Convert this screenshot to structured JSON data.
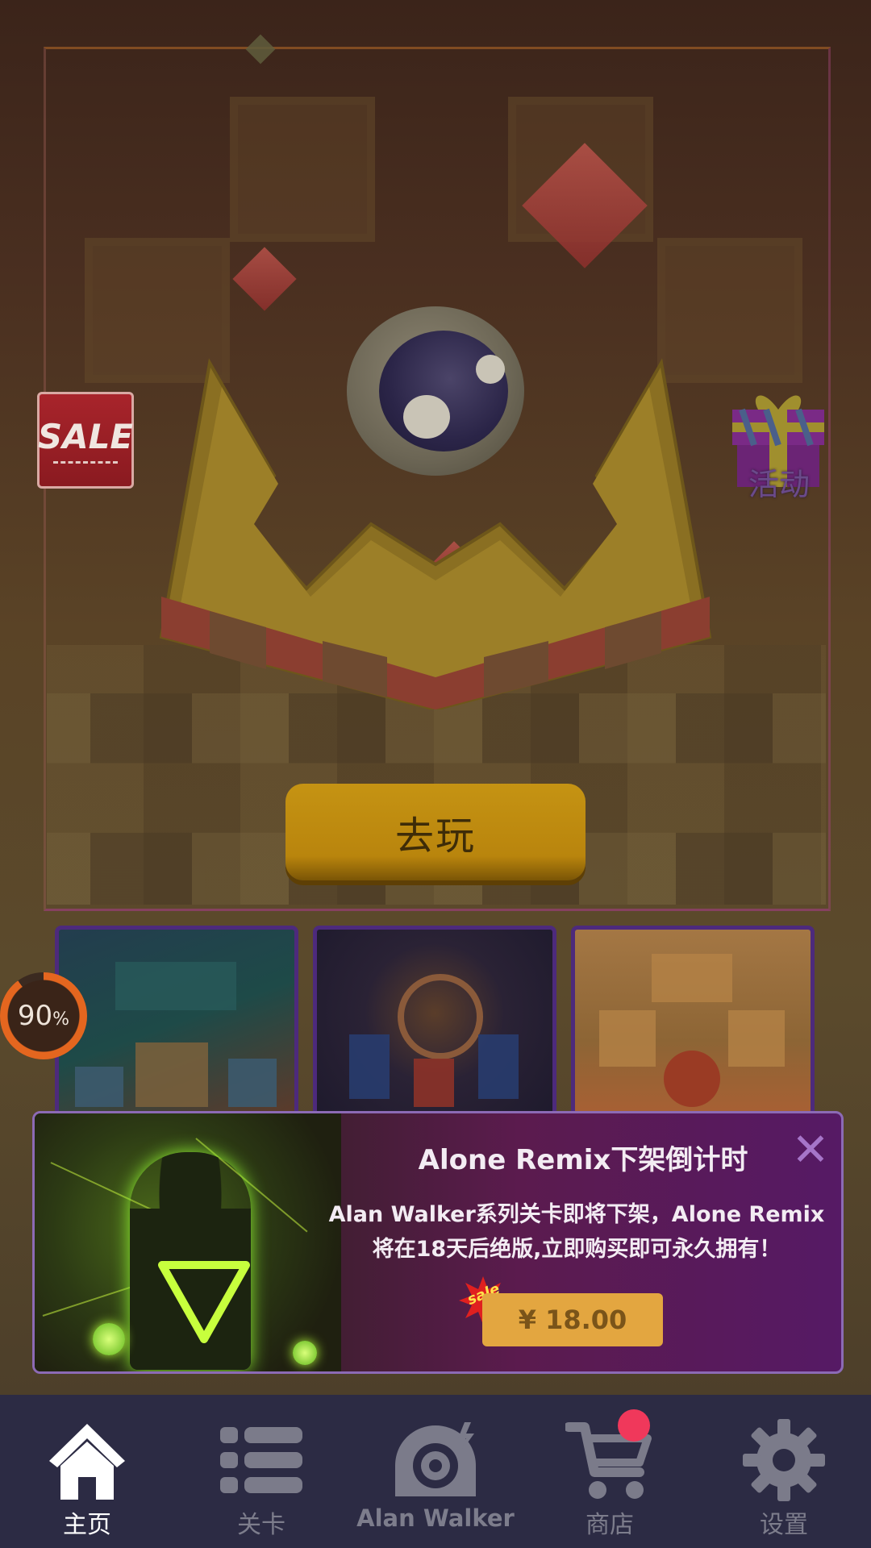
{
  "stage": {
    "play_button_label": "去玩",
    "sale_badge_label": "SALE",
    "gift_label": "活动"
  },
  "progress": {
    "value": "90",
    "unit": "%"
  },
  "promo": {
    "title": "Alone Remix下架倒计时",
    "close_icon": "close-icon",
    "body": "Alan Walker系列关卡即将下架，Alone Remix将在18天后绝版,立即购买即可永久拥有！",
    "sale_tag": "sale",
    "price_label": "¥ 18.00"
  },
  "nav": {
    "items": [
      {
        "label": "主页",
        "icon": "home-icon",
        "active": true
      },
      {
        "label": "关卡",
        "icon": "list-icon",
        "active": false
      },
      {
        "label": "Alan Walker",
        "icon": "music-disc-icon",
        "active": false
      },
      {
        "label": "商店",
        "icon": "cart-icon",
        "active": false,
        "badge": true
      },
      {
        "label": "设置",
        "icon": "gear-icon",
        "active": false
      }
    ]
  },
  "colors": {
    "nav_bg": "#2c2b44",
    "play_button": "#c59313",
    "price_button": "#e3a640",
    "badge": "#f0385b",
    "progress_ring": "#e4661f"
  }
}
